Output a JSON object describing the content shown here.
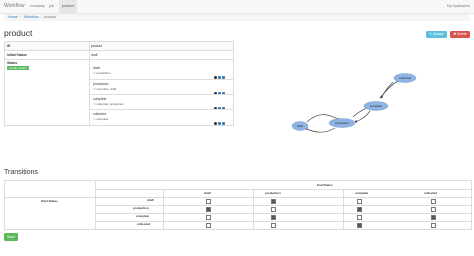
{
  "navbar": {
    "brand": "Workflow",
    "links": [
      "company",
      "job",
      "product"
    ],
    "active_index": 2,
    "right_text": "My Application"
  },
  "breadcrumb": [
    "Home",
    "Workflow",
    "product"
  ],
  "page_title": "product",
  "buttons": {
    "update": "✎ Update",
    "delete": "✖ Delete",
    "save": "Save"
  },
  "info_table": {
    "id_label": "ID",
    "id_value": "product",
    "initial_status_label": "Initial Status",
    "initial_status_value": "draft",
    "status_label": "Status",
    "current_badge": "Create status",
    "statuses": [
      {
        "name": "draft",
        "target": "production"
      },
      {
        "name": "production",
        "target": "complete, draft"
      },
      {
        "name": "complete",
        "target": "collected, production"
      },
      {
        "name": "collected",
        "target": "complete"
      }
    ]
  },
  "graph": {
    "nodes": [
      "draft",
      "production",
      "complete",
      "collected"
    ],
    "accent": "#8fb4e3"
  },
  "transitions": {
    "title": "Transitions",
    "end_status_label": "End Status",
    "start_status_label": "Start Status",
    "columns": [
      "draft",
      "production",
      "complete",
      "collected"
    ],
    "rows": [
      {
        "name": "draft",
        "checks": [
          false,
          true,
          false,
          false
        ]
      },
      {
        "name": "production",
        "checks": [
          true,
          false,
          true,
          false
        ]
      },
      {
        "name": "complete",
        "checks": [
          false,
          true,
          false,
          true
        ]
      },
      {
        "name": "collected",
        "checks": [
          false,
          false,
          true,
          false
        ]
      }
    ]
  }
}
